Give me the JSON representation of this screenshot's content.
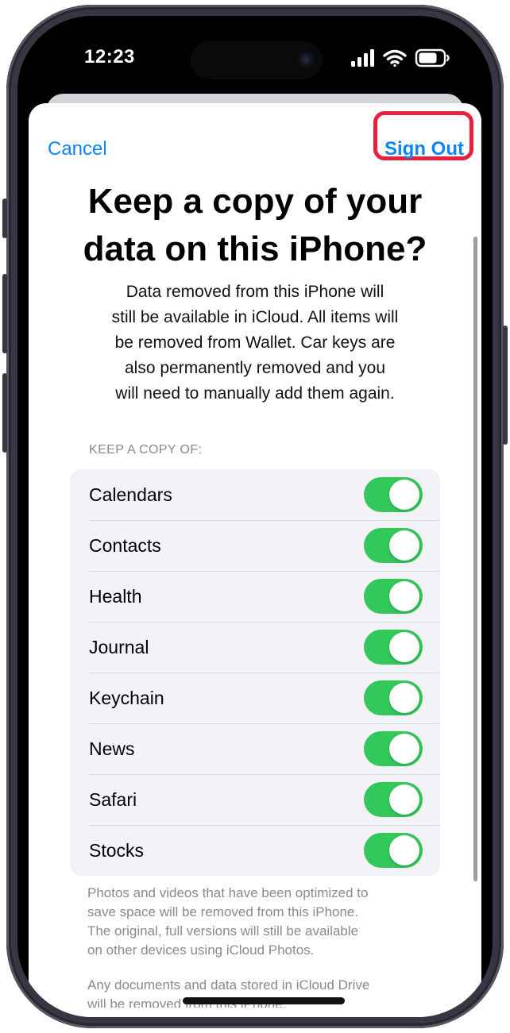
{
  "status": {
    "time": "12:23",
    "icons": [
      "cellular-signal-icon",
      "wifi-icon",
      "battery-icon"
    ]
  },
  "nav": {
    "cancel_label": "Cancel",
    "signout_label": "Sign Out"
  },
  "dialog": {
    "title_line1": "Keep a copy of your",
    "title_line2": "data on this iPhone?",
    "desc_lines": [
      "Data removed from this iPhone will",
      "still be available in iCloud. All items will",
      "be removed from Wallet. Car keys are",
      "also permanently removed and you",
      "will need to manually add them again."
    ]
  },
  "keep_copy": {
    "header": "KEEP A COPY OF:",
    "items": [
      {
        "label": "Calendars",
        "on": true
      },
      {
        "label": "Contacts",
        "on": true
      },
      {
        "label": "Health",
        "on": true
      },
      {
        "label": "Journal",
        "on": true
      },
      {
        "label": "Keychain",
        "on": true
      },
      {
        "label": "News",
        "on": true
      },
      {
        "label": "Safari",
        "on": true
      },
      {
        "label": "Stocks",
        "on": true
      }
    ]
  },
  "footer": {
    "photos_lines": [
      "Photos and videos that have been optimized to",
      "save space will be removed from this iPhone.",
      "The original, full versions will still be available",
      "on other devices using iCloud Photos."
    ],
    "drive_lines": [
      "Any documents and data stored in iCloud Drive",
      "will be removed from this iPhone."
    ]
  },
  "colors": {
    "accent": "#0a84ff",
    "toggle_on": "#34c759",
    "highlight_ring": "#e8203c"
  }
}
